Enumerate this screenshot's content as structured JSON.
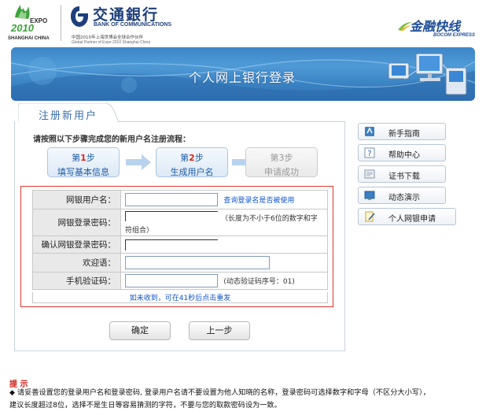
{
  "header": {
    "expo": {
      "top": "EXPO",
      "year": "2010",
      "city": "SHANGHAI CHINA"
    },
    "bank": {
      "name_cn": "交通銀行",
      "name_en": "BANK OF COMMUNICATIONS",
      "partner_cn": "中国2010年上海世博会全球合作伙伴",
      "partner_en": "Global Partner of Expo 2010 Shanghai China"
    },
    "express": {
      "name_cn": "金融快线",
      "name_en": "BOCOM EXPRESS"
    }
  },
  "banner": {
    "title": "个人网上银行登录"
  },
  "tab": {
    "label": "注册新用户"
  },
  "instruction": "请按照以下步骤完成您的新用户名注册流程：",
  "steps": [
    {
      "prefix": "第",
      "num": "1",
      "suffix": "步",
      "label": "填写基本信息",
      "state": "done"
    },
    {
      "prefix": "第",
      "num": "2",
      "suffix": "步",
      "label": "生成用户名",
      "state": "current"
    },
    {
      "prefix": "第",
      "num": "3",
      "suffix": "步",
      "label": "申请成功",
      "state": "disabled"
    }
  ],
  "form": {
    "username": {
      "label": "网银用户名：",
      "value": "",
      "link": "查询登录名是否被使用"
    },
    "password": {
      "label": "网银登录密码：",
      "value": "",
      "hint": "（长度为不小于6位的数字和字符组合）"
    },
    "confirm": {
      "label": "确认网银登录密码：",
      "value": ""
    },
    "greeting": {
      "label": "欢迎语：",
      "value": ""
    },
    "sms": {
      "label": "手机验证码：",
      "value": "",
      "hint": "(动态验证码序号：01)"
    },
    "resend": "如未收到，可在41秒后点击重发"
  },
  "buttons": {
    "confirm": "确定",
    "back": "上一步"
  },
  "sidebar": [
    {
      "label": "新手指南",
      "icon": "guide-icon"
    },
    {
      "label": "帮助中心",
      "icon": "help-icon"
    },
    {
      "label": "证书下载",
      "icon": "certificate-icon"
    },
    {
      "label": "动态演示",
      "icon": "demo-icon"
    },
    {
      "label": "个人网银申请",
      "icon": "apply-icon"
    }
  ],
  "notice": {
    "title": "提 示",
    "line1": "请妥善设置您的登录用户名和登录密码, 登录用户名请不要设置为他人知晓的名称，登录密码可选择数字和字母（不区分大小写），",
    "line2": "建议长度超过8位，选择不是生日等容易猜测的字符，不要与您的取款密码设为一致。"
  },
  "colors": {
    "accent": "#1f5ca6",
    "red": "#e2231a",
    "banner": "#3d86c8"
  }
}
